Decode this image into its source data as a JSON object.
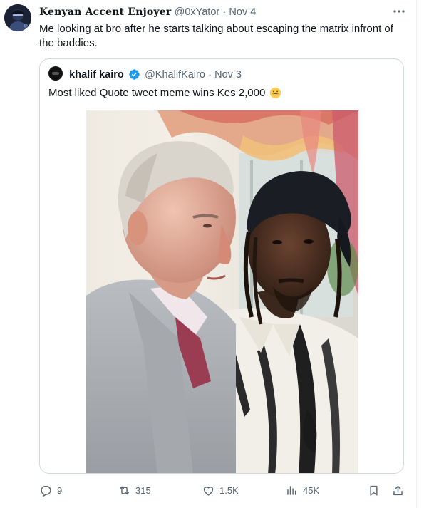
{
  "tweet": {
    "display_name": "Kenyan Accent Enjoyer",
    "handle": "@0xYator",
    "separator": "·",
    "date": "Nov 4",
    "text": "Me looking at bro after he starts talking about escaping the matrix infront of the baddies.",
    "more_icon": "more-horizontal-icon"
  },
  "quoted_tweet": {
    "display_name": "khalif kairo",
    "verified": true,
    "handle": "@KhalifKairo",
    "separator": "·",
    "date": "Nov 3",
    "text": "Most liked Quote tweet meme wins Kes 2,000",
    "emoji": "grinning-face-emoji"
  },
  "actions": {
    "reply": {
      "icon": "reply-icon",
      "count": "9"
    },
    "retweet": {
      "icon": "retweet-icon",
      "count": "315"
    },
    "like": {
      "icon": "heart-icon",
      "count": "1.5K"
    },
    "views": {
      "icon": "views-chart-icon",
      "count": "45K"
    },
    "bookmark": {
      "icon": "bookmark-icon"
    },
    "share": {
      "icon": "share-icon"
    }
  },
  "colors": {
    "text_primary": "#0f1419",
    "text_secondary": "#536471",
    "border": "#cfd9de",
    "verified_blue": "#1d9bf0"
  }
}
